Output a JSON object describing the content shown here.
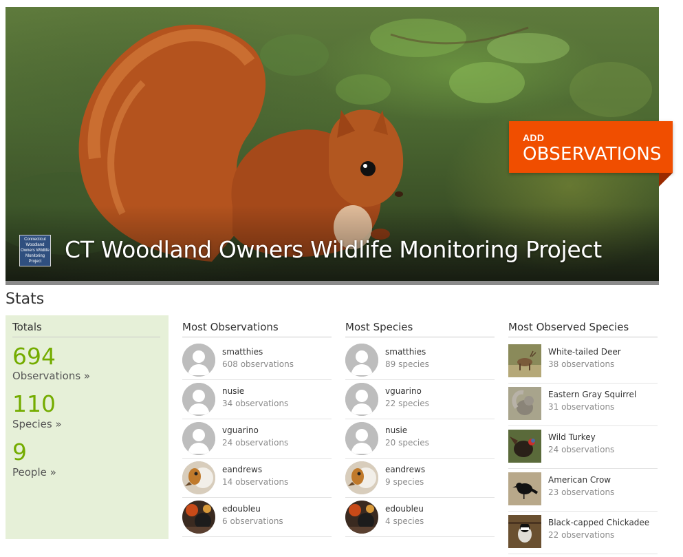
{
  "banner": {
    "project_icon_text": "Connecticut Woodland Owners Wildlife Monitoring Project",
    "title": "CT Woodland Owners Wildlife Monitoring Project",
    "add_button": {
      "line1": "ADD",
      "line2": "OBSERVATIONS"
    },
    "accent_color": "#f04e00"
  },
  "stats": {
    "heading": "Stats",
    "totals": {
      "header": "Totals",
      "observations": {
        "count": "694",
        "label": "Observations »"
      },
      "species": {
        "count": "110",
        "label": "Species »"
      },
      "people": {
        "count": "9",
        "label": "People »"
      },
      "number_color": "#74ac00",
      "panel_color": "#e6f0d8"
    },
    "most_observations": {
      "header": "Most Observations",
      "rows": [
        {
          "name": "smatthies",
          "value": "608 observations",
          "avatar": "default-user-icon"
        },
        {
          "name": "nusie",
          "value": "34 observations",
          "avatar": "default-user-icon"
        },
        {
          "name": "vguarino",
          "value": "24 observations",
          "avatar": "default-user-icon"
        },
        {
          "name": "eandrews",
          "value": "14 observations",
          "avatar": "bird-photo"
        },
        {
          "name": "edoubleu",
          "value": "6 observations",
          "avatar": "photo"
        }
      ]
    },
    "most_species": {
      "header": "Most Species",
      "rows": [
        {
          "name": "smatthies",
          "value": "89 species",
          "avatar": "default-user-icon"
        },
        {
          "name": "vguarino",
          "value": "22 species",
          "avatar": "default-user-icon"
        },
        {
          "name": "nusie",
          "value": "20 species",
          "avatar": "default-user-icon"
        },
        {
          "name": "eandrews",
          "value": "9 species",
          "avatar": "bird-photo"
        },
        {
          "name": "edoubleu",
          "value": "4 species",
          "avatar": "photo"
        }
      ]
    },
    "most_observed_species": {
      "header": "Most Observed Species",
      "rows": [
        {
          "name": "White-tailed Deer",
          "value": "38 observations"
        },
        {
          "name": "Eastern Gray Squirrel",
          "value": "31 observations"
        },
        {
          "name": "Wild Turkey",
          "value": "24 observations"
        },
        {
          "name": "American Crow",
          "value": "23 observations"
        },
        {
          "name": "Black-capped Chickadee",
          "value": "22 observations"
        }
      ]
    }
  }
}
